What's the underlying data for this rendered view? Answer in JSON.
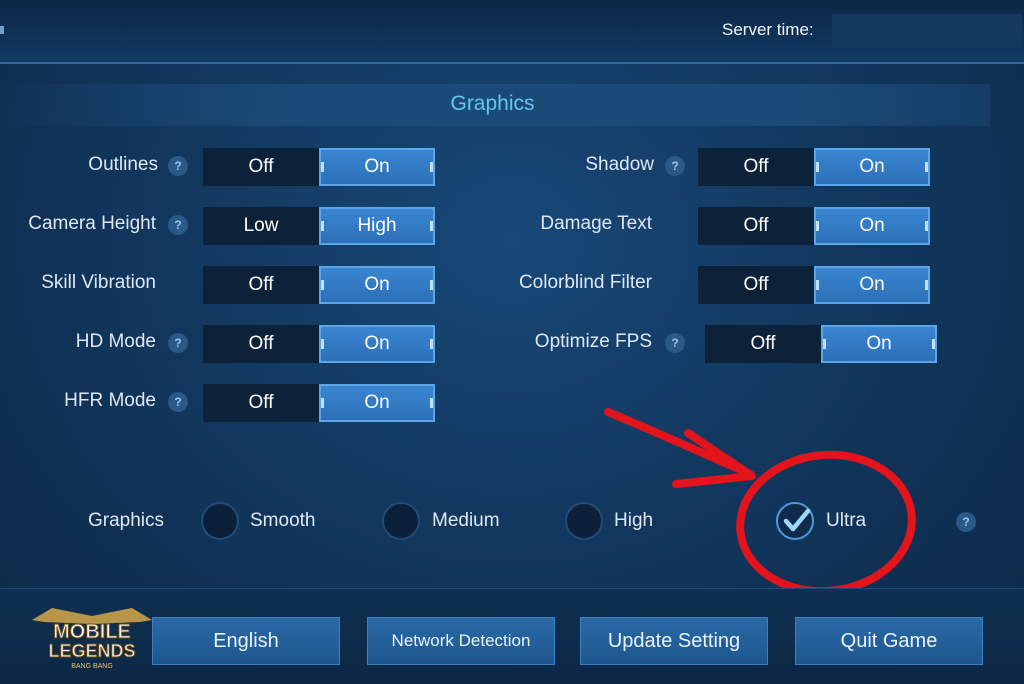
{
  "header": {
    "server_time_label": "Server time:"
  },
  "section": {
    "title": "Graphics"
  },
  "settings_left": [
    {
      "label": "Outlines",
      "has_help": true,
      "options": [
        "Off",
        "On"
      ],
      "selected": "On"
    },
    {
      "label": "Camera Height",
      "has_help": true,
      "options": [
        "Low",
        "High"
      ],
      "selected": "High"
    },
    {
      "label": "Skill Vibration",
      "has_help": false,
      "options": [
        "Off",
        "On"
      ],
      "selected": "On"
    },
    {
      "label": "HD Mode",
      "has_help": true,
      "options": [
        "Off",
        "On"
      ],
      "selected": "On"
    },
    {
      "label": "HFR Mode",
      "has_help": true,
      "options": [
        "Off",
        "On"
      ],
      "selected": "On"
    }
  ],
  "settings_right": [
    {
      "label": "Shadow",
      "has_help": true,
      "options": [
        "Off",
        "On"
      ],
      "selected": "On"
    },
    {
      "label": "Damage Text",
      "has_help": false,
      "options": [
        "Off",
        "On"
      ],
      "selected": "On"
    },
    {
      "label": "Colorblind Filter",
      "has_help": false,
      "options": [
        "Off",
        "On"
      ],
      "selected": "On"
    },
    {
      "label": "Optimize FPS",
      "has_help": true,
      "options": [
        "Off",
        "On"
      ],
      "selected": "On"
    }
  ],
  "graphics_quality": {
    "label": "Graphics",
    "options": [
      "Smooth",
      "Medium",
      "High",
      "Ultra"
    ],
    "selected": "Ultra"
  },
  "help_glyph": "?",
  "footer": {
    "logo_text": [
      "MOBILE",
      "LEGENDS",
      "BANG BANG"
    ],
    "buttons": [
      "English",
      "Network Detection",
      "Update Setting",
      "Quit Game"
    ]
  },
  "colors": {
    "background": "#113457",
    "accent": "#62c6f0",
    "toggle_active": "#2b6fb6",
    "toggle_inactive": "#0d2238",
    "annotation": "#e3141b"
  },
  "icons": {
    "help": "question-circle-icon",
    "check": "checkmark-icon",
    "annotation_arrow": "red-arrow-annotation",
    "annotation_circle": "red-circle-annotation"
  }
}
